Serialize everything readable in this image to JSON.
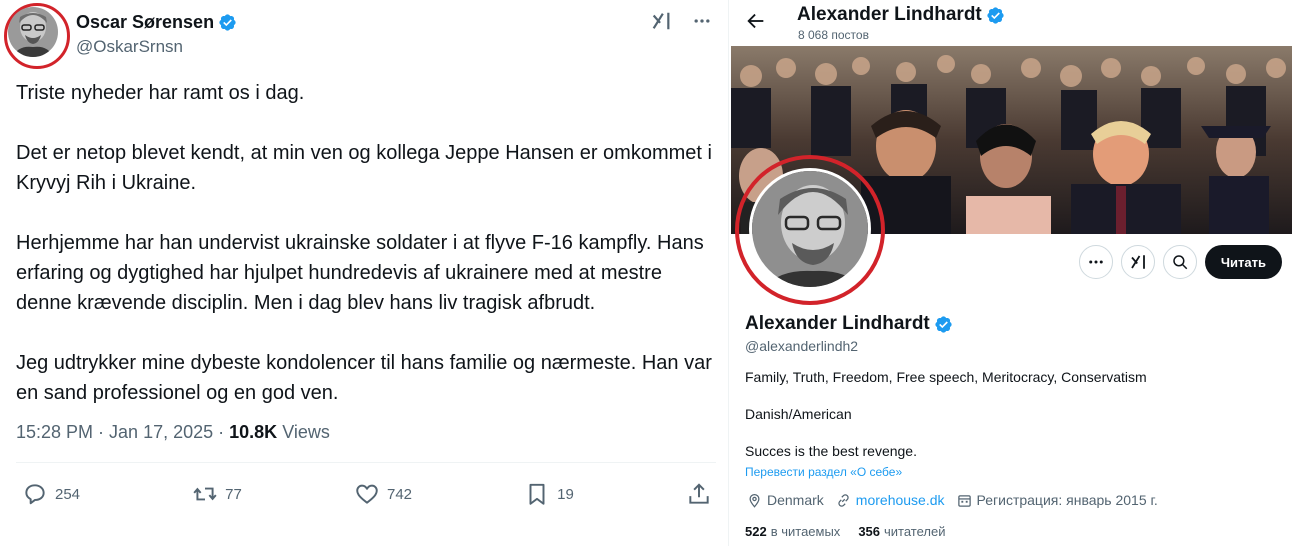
{
  "tweet": {
    "author_name": "Oscar Sørensen",
    "author_handle": "@OskarSrnsn",
    "paragraphs": [
      "Triste nyheder har ramt os i dag.",
      "Det er netop blevet kendt, at min ven og kollega Jeppe Hansen er omkommet i Kryvyj Rih i Ukraine.",
      "Herhjemme har han undervist ukrainske soldater i at flyve F-16 kampfly. Hans erfaring og dygtighed har hjulpet hundredevis af ukrainere med at mestre denne krævende disciplin. Men i dag blev hans liv tragisk afbrudt.",
      "Jeg udtrykker mine dybeste kondolencer til hans familie og nærmeste. Han var en sand professionel og en god ven."
    ],
    "timestamp": "15:28 PM · Jan 17, 2025 ·",
    "views_count": "10.8K",
    "views_label": "Views",
    "actions": {
      "replies": "254",
      "reposts": "77",
      "likes": "742",
      "bookmarks": "19"
    },
    "icons": [
      "grok-icon",
      "more-icon",
      "reply-icon",
      "repost-icon",
      "like-icon",
      "bookmark-icon",
      "share-icon"
    ]
  },
  "profile": {
    "header_name": "Alexander Lindhardt",
    "posts_count": "8 068 постов",
    "display_name": "Alexander Lindhardt",
    "handle": "@alexanderlindh2",
    "bio_lines": [
      "Family, Truth, Freedom, Free speech, Meritocracy, Conservatism",
      "Danish/American",
      "Succes is the best revenge."
    ],
    "translate_link": "Перевести раздел «О себе»",
    "location": "Denmark",
    "website": "morehouse.dk",
    "joined": "Регистрация: январь 2015 г.",
    "following_count": "522",
    "following_label": "в читаемых",
    "followers_count": "356",
    "followers_label": "читателей",
    "follow_button": "Читать"
  },
  "colors": {
    "highlight_ring": "#d2232a",
    "verified": "#1d9bf0",
    "muted_text": "#536471",
    "primary_text": "#0f1419"
  }
}
